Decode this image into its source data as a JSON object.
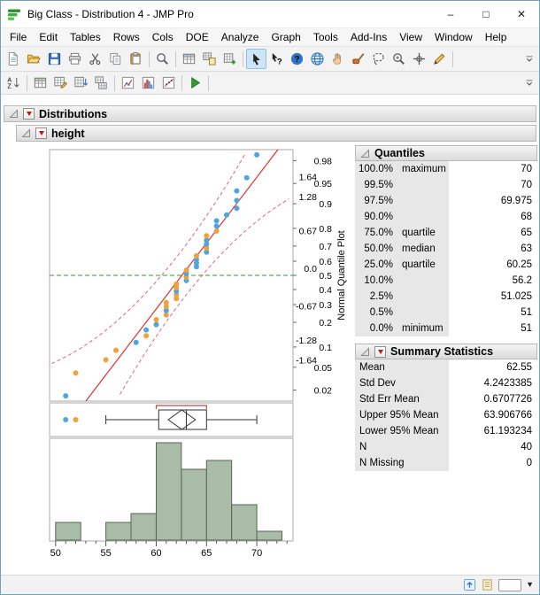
{
  "window": {
    "title": "Big Class - Distribution 4 - JMP Pro",
    "controls": {
      "minimize": "–",
      "maximize": "□",
      "close": "✕"
    }
  },
  "menu": {
    "items": [
      "File",
      "Edit",
      "Tables",
      "Rows",
      "Cols",
      "DOE",
      "Analyze",
      "Graph",
      "Tools",
      "Add-Ins",
      "View",
      "Window",
      "Help"
    ]
  },
  "toolbar": {
    "active_tool": "arrow-tool",
    "row1": [
      "new-journal",
      "open-file",
      "save-file",
      "print",
      "cut",
      "copy",
      "paste",
      "|",
      "zoom-region",
      "|",
      "data-table",
      "paste-table",
      "add-table",
      "|",
      "arrow-tool",
      "help-tool",
      "question-tool",
      "globe-tool",
      "grabber-tool",
      "brush-tool",
      "lasso-tool",
      "magnifier-tool",
      "crosshair-tool",
      "annotate-tool",
      "|"
    ],
    "row2": [
      "sort-az",
      "|",
      "new-data-table",
      "table-pencil",
      "table-sort",
      "table-stack",
      "|",
      "graph-builder",
      "distribution-icon",
      "fit-icon",
      "|",
      "run-script",
      "|"
    ]
  },
  "outline": {
    "distributions": "Distributions",
    "height": "height"
  },
  "report": {
    "quantiles": {
      "title": "Quantiles",
      "rows": [
        [
          "100.0%",
          "maximum",
          "70"
        ],
        [
          "99.5%",
          "",
          "70"
        ],
        [
          "97.5%",
          "",
          "69.975"
        ],
        [
          "90.0%",
          "",
          "68"
        ],
        [
          "75.0%",
          "quartile",
          "65"
        ],
        [
          "50.0%",
          "median",
          "63"
        ],
        [
          "25.0%",
          "quartile",
          "60.25"
        ],
        [
          "10.0%",
          "",
          "56.2"
        ],
        [
          "2.5%",
          "",
          "51.025"
        ],
        [
          "0.5%",
          "",
          "51"
        ],
        [
          "0.0%",
          "minimum",
          "51"
        ]
      ]
    },
    "summary": {
      "title": "Summary Statistics",
      "rows": [
        [
          "Mean",
          "62.55"
        ],
        [
          "Std Dev",
          "4.2423385"
        ],
        [
          "Std Err Mean",
          "0.6707726"
        ],
        [
          "Upper 95% Mean",
          "63.906766"
        ],
        [
          "Lower 95% Mean",
          "61.193234"
        ],
        [
          "N",
          "40"
        ],
        [
          "N Missing",
          "0"
        ]
      ]
    }
  },
  "chart_data": {
    "type": "distribution",
    "variable": "height",
    "x_axis": {
      "min": 49.4,
      "max": 73.6,
      "ticks": [
        50,
        55,
        60,
        65,
        70
      ]
    },
    "normal_quantile_plot": {
      "ylabel": "Normal Quantile Plot",
      "probability_ticks": [
        {
          "label": "0.98",
          "z": 2.054
        },
        {
          "label": "0.95",
          "z": 1.645
        },
        {
          "label": "0.9",
          "z": 1.282
        },
        {
          "label": "0.8",
          "z": 0.842
        },
        {
          "label": "0.7",
          "z": 0.524
        },
        {
          "label": "0.6",
          "z": 0.253
        },
        {
          "label": "0.5",
          "z": 0.0
        },
        {
          "label": "0.4",
          "z": -0.253
        },
        {
          "label": "0.3",
          "z": -0.524
        },
        {
          "label": "0.2",
          "z": -0.842
        },
        {
          "label": "0.1",
          "z": -1.282
        },
        {
          "label": "0.05",
          "z": -1.645
        },
        {
          "label": "0.02",
          "z": -2.054
        }
      ],
      "quantile_ticks": [
        {
          "label": "1.64",
          "z": 1.64
        },
        {
          "label": "1.28",
          "z": 1.28
        },
        {
          "label": "0.67",
          "z": 0.67
        },
        {
          "label": "0.0",
          "z": 0.0
        },
        {
          "label": "-0.67",
          "z": -0.67
        },
        {
          "label": "-1.28",
          "z": -1.28
        },
        {
          "label": "-1.64",
          "z": -1.64
        }
      ],
      "fit_line": {
        "mean": 62.55,
        "sd": 4.2423385,
        "color": "#e03030"
      },
      "median_line": {
        "z": 0,
        "color": "#2e9e2e"
      },
      "band_color": "#e8637a",
      "colors": {
        "M": "#4da6dd",
        "F": "#f0a13a"
      },
      "points": [
        {
          "v": 51,
          "z": -2.157,
          "sex": "M"
        },
        {
          "v": 52,
          "z": -1.747,
          "sex": "F"
        },
        {
          "v": 55,
          "z": -1.512,
          "sex": "F"
        },
        {
          "v": 56,
          "z": -1.34,
          "sex": "F"
        },
        {
          "v": 58,
          "z": -1.2,
          "sex": "M"
        },
        {
          "v": 59,
          "z": -1.081,
          "sex": "F"
        },
        {
          "v": 59,
          "z": -0.976,
          "sex": "M"
        },
        {
          "v": 60,
          "z": -0.881,
          "sex": "M"
        },
        {
          "v": 60,
          "z": -0.792,
          "sex": "F"
        },
        {
          "v": 61,
          "z": -0.709,
          "sex": "F"
        },
        {
          "v": 61,
          "z": -0.631,
          "sex": "M"
        },
        {
          "v": 61,
          "z": -0.557,
          "sex": "F"
        },
        {
          "v": 61,
          "z": -0.486,
          "sex": "F"
        },
        {
          "v": 62,
          "z": -0.417,
          "sex": "F"
        },
        {
          "v": 62,
          "z": -0.349,
          "sex": "F"
        },
        {
          "v": 62,
          "z": -0.284,
          "sex": "M"
        },
        {
          "v": 62,
          "z": -0.22,
          "sex": "F"
        },
        {
          "v": 62,
          "z": -0.156,
          "sex": "F"
        },
        {
          "v": 63,
          "z": -0.094,
          "sex": "M"
        },
        {
          "v": 63,
          "z": -0.031,
          "sex": "F"
        },
        {
          "v": 63,
          "z": 0.031,
          "sex": "M"
        },
        {
          "v": 63,
          "z": 0.094,
          "sex": "F"
        },
        {
          "v": 64,
          "z": 0.156,
          "sex": "M"
        },
        {
          "v": 64,
          "z": 0.22,
          "sex": "M"
        },
        {
          "v": 64,
          "z": 0.284,
          "sex": "M"
        },
        {
          "v": 64,
          "z": 0.349,
          "sex": "F"
        },
        {
          "v": 65,
          "z": 0.417,
          "sex": "M"
        },
        {
          "v": 65,
          "z": 0.486,
          "sex": "F"
        },
        {
          "v": 65,
          "z": 0.557,
          "sex": "M"
        },
        {
          "v": 65,
          "z": 0.631,
          "sex": "M"
        },
        {
          "v": 65,
          "z": 0.709,
          "sex": "F"
        },
        {
          "v": 66,
          "z": 0.792,
          "sex": "F"
        },
        {
          "v": 66,
          "z": 0.881,
          "sex": "M"
        },
        {
          "v": 66,
          "z": 0.976,
          "sex": "M"
        },
        {
          "v": 67,
          "z": 1.081,
          "sex": "M"
        },
        {
          "v": 68,
          "z": 1.2,
          "sex": "M"
        },
        {
          "v": 68,
          "z": 1.34,
          "sex": "M"
        },
        {
          "v": 68,
          "z": 1.512,
          "sex": "M"
        },
        {
          "v": 69,
          "z": 1.747,
          "sex": "M"
        },
        {
          "v": 70,
          "z": 2.157,
          "sex": "M"
        }
      ]
    },
    "box_plot": {
      "min_whisker": 55,
      "q1": 60.25,
      "median": 63,
      "q3": 65,
      "max_whisker": 70,
      "mean": 62.55,
      "ci_low": 61.193234,
      "ci_high": 63.906766,
      "outliers": [
        {
          "v": 51,
          "sex": "M"
        },
        {
          "v": 52,
          "sex": "F"
        }
      ],
      "shortest_half": [
        60,
        65
      ]
    },
    "histogram": {
      "bin_start": 50,
      "bin_width": 2.5,
      "counts": [
        2,
        0,
        2,
        3,
        11,
        8,
        9,
        4,
        1
      ],
      "bar_color": "#a8bca8",
      "bar_border": "#55684f"
    }
  },
  "statusbar": {
    "icons": [
      "status-up",
      "status-journal"
    ]
  }
}
